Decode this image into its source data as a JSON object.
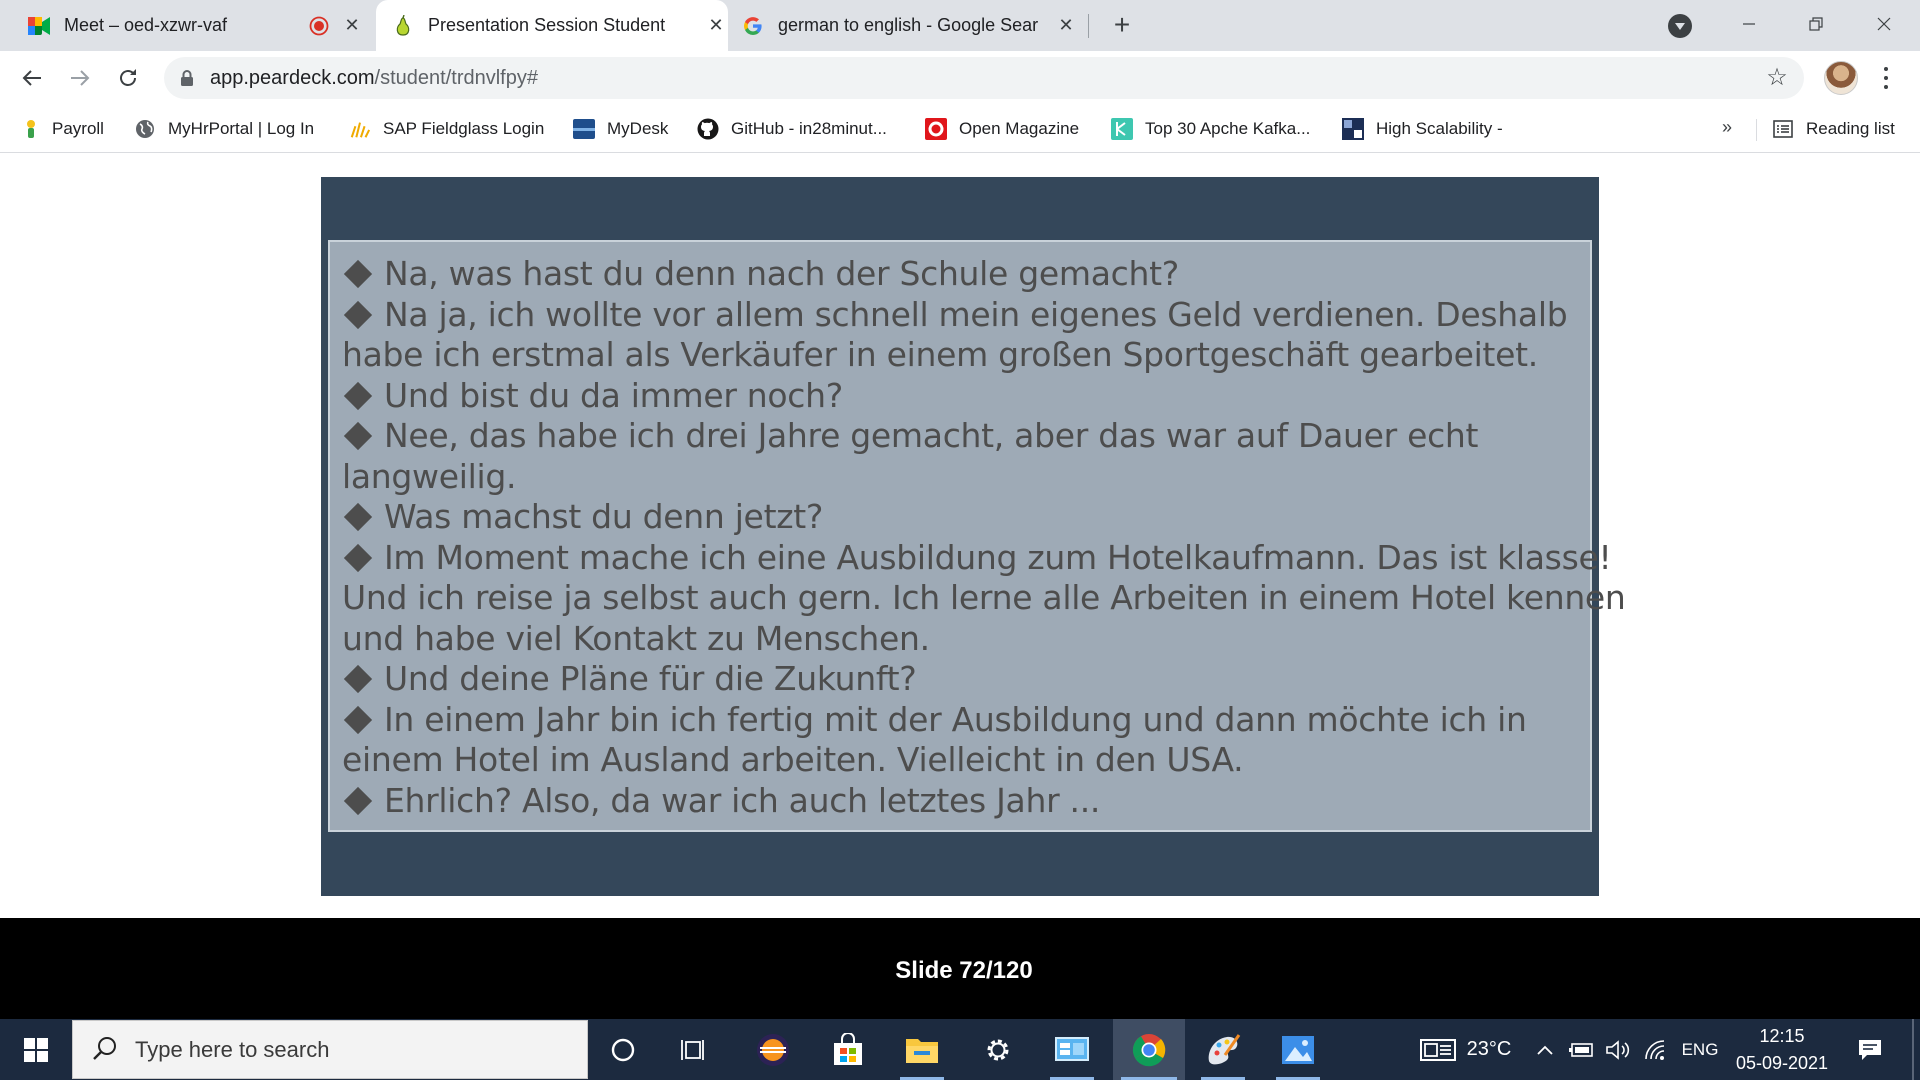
{
  "browser": {
    "tabs": [
      {
        "title": "Meet – oed-xzwr-vaf",
        "icon": "google-meet-icon",
        "recording": true
      },
      {
        "title": "Presentation Session Student",
        "icon": "peardeck-icon",
        "active": true
      },
      {
        "title": "german to english - Google Sear",
        "icon": "google-icon"
      }
    ],
    "new_tab_label": "+",
    "url_host": "app.peardeck.com",
    "url_path": "/student/trdnvlfpy#"
  },
  "bookmarks": {
    "items": [
      {
        "label": "Payroll",
        "icon": "payroll-icon"
      },
      {
        "label": "MyHrPortal | Log In",
        "icon": "globe-icon"
      },
      {
        "label": "SAP Fieldglass Login",
        "icon": "fieldglass-icon"
      },
      {
        "label": "MyDesk",
        "icon": "mydesk-icon"
      },
      {
        "label": "GitHub - in28minut...",
        "icon": "github-icon"
      },
      {
        "label": "Open Magazine",
        "icon": "open-magazine-icon"
      },
      {
        "label": "Top 30 Apche Kafka...",
        "icon": "kafka-icon"
      },
      {
        "label": "High Scalability -",
        "icon": "high-scalability-icon"
      }
    ],
    "overflow": "»",
    "reading_list": "Reading list"
  },
  "slide": {
    "lines": [
      {
        "text": "Na, was hast du denn nach der Schule gemacht?",
        "bullet": true
      },
      {
        "text": "Na ja, ich wollte vor allem schnell mein eigenes Geld verdienen. Deshalb",
        "bullet": true
      },
      {
        "text": "habe ich erstmal als Verkäufer in einem großen Sportgeschäft gearbeitet.",
        "bullet": false
      },
      {
        "text": "Und bist du da immer noch?",
        "bullet": true
      },
      {
        "text": "Nee, das habe ich drei Jahre gemacht, aber das war auf Dauer echt",
        "bullet": true
      },
      {
        "text": "langweilig.",
        "bullet": false
      },
      {
        "text": "Was machst du denn jetzt?",
        "bullet": true
      },
      {
        "text": "Im Moment mache ich eine Ausbildung zum Hotelkaufmann. Das ist klasse!",
        "bullet": true
      },
      {
        "text": "Und ich reise ja selbst auch gern. Ich lerne alle Arbeiten in einem Hotel kennen",
        "bullet": false
      },
      {
        "text": "und habe viel Kontakt zu Menschen.",
        "bullet": false
      },
      {
        "text": "Und deine Pläne für die Zukunft?",
        "bullet": true
      },
      {
        "text": "In einem Jahr bin ich fertig mit der Ausbildung und dann möchte ich in",
        "bullet": true
      },
      {
        "text": "einem Hotel im Ausland arbeiten. Vielleicht in den USA.",
        "bullet": false
      },
      {
        "text": "Ehrlich? Also, da war ich auch letztes Jahr ...",
        "bullet": true
      }
    ],
    "counter": "Slide 72/120"
  },
  "taskbar": {
    "search_placeholder": "Type here to search",
    "apps": [
      "cortana-icon",
      "task-view-icon",
      "eclipse-icon",
      "store-icon",
      "file-explorer-icon",
      "settings-icon",
      "control-panel-icon",
      "chrome-icon",
      "paint-icon",
      "photos-icon"
    ],
    "weather": "23°C",
    "language": "ENG",
    "time": "12:15",
    "date": "05-09-2021"
  }
}
